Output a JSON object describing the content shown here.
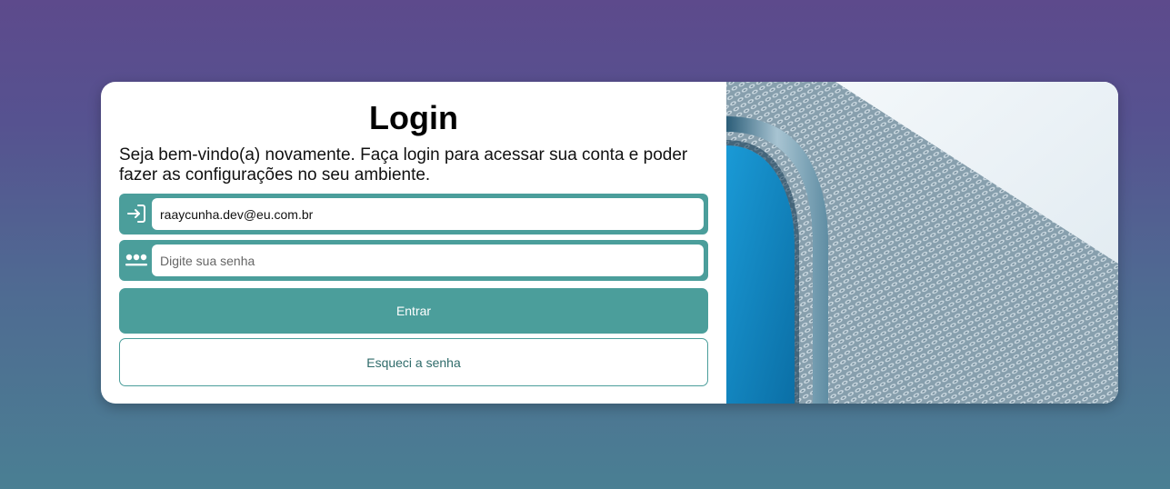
{
  "login": {
    "title": "Login",
    "subtitle": "Seja bem-vindo(a) novamente. Faça login para acessar sua conta e poder fazer as configurações no seu ambiente.",
    "email": {
      "value": "raaycunha.dev@eu.com.br",
      "icon": "login-arrow-icon"
    },
    "password": {
      "placeholder": "Digite sua senha",
      "icon": "password-dots-icon"
    },
    "submit_label": "Entrar",
    "forgot_label": "Esqueci a senha"
  },
  "colors": {
    "accent": "#4b9e9b",
    "card_background": "#ffffff",
    "page_gradient_top": "#5d4a8c",
    "page_gradient_bottom": "#4a7f93"
  },
  "image": {
    "description_icon": "building-facade-image"
  }
}
